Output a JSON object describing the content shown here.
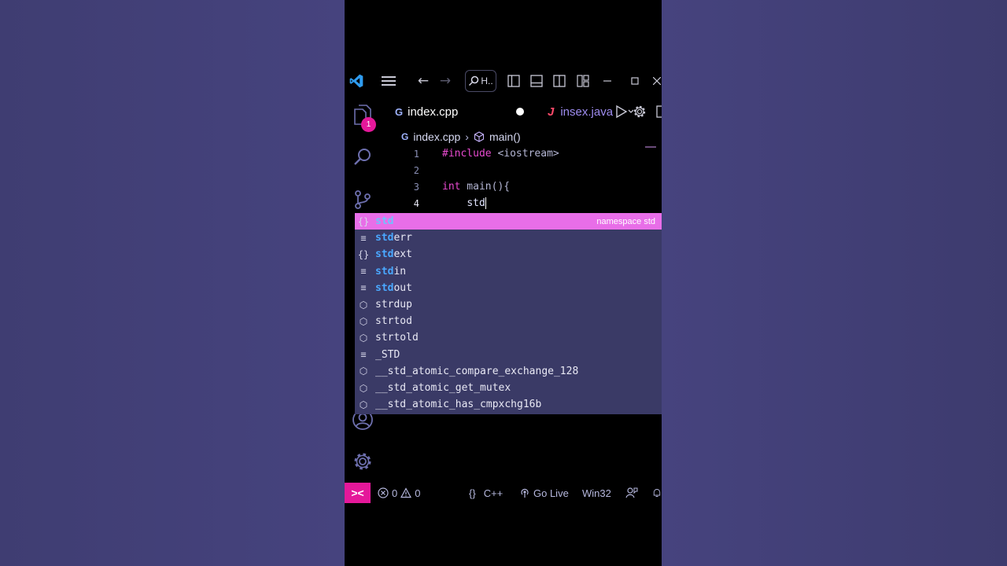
{
  "colors": {
    "accent": "#e5189a",
    "suggest_selected": "#e86ee8",
    "match_highlight": "#4aa8ff",
    "background": "#3f3f72"
  },
  "titlebar": {
    "search_label": "H..",
    "icons": [
      "vscode-logo-icon",
      "menu-icon",
      "back-arrow-icon",
      "forward-arrow-icon",
      "search-icon",
      "toggle-sidebar-icon",
      "toggle-panel-icon",
      "toggle-secondary-sidebar-icon",
      "customize-layout-icon",
      "minimize-icon",
      "maximize-icon",
      "close-icon"
    ]
  },
  "activity_bar": {
    "badge": "1",
    "icons": [
      "explorer-icon",
      "search-icon",
      "source-control-icon",
      "account-icon",
      "settings-gear-icon"
    ]
  },
  "tabs": [
    {
      "label": "index.cpp",
      "icon": "cpp-file-icon",
      "icon_glyph": "G",
      "active": true,
      "modified": true
    },
    {
      "label": "insex.java",
      "icon": "java-file-icon",
      "icon_glyph": "J",
      "active": false
    }
  ],
  "breadcrumb": {
    "file": "index.cpp",
    "file_icon_glyph": "G",
    "symbol": "main()"
  },
  "editor": {
    "lines": [
      {
        "number": "1",
        "hash": "#",
        "directive": "include",
        "rest": " <iostream>"
      },
      {
        "number": "2"
      },
      {
        "number": "3",
        "keyword": "int",
        "rest": " main(){"
      },
      {
        "number": "4",
        "indent": "    ",
        "text": "std"
      }
    ]
  },
  "suggestions": [
    {
      "match": "std",
      "rest": "",
      "kind": "namespace-icon",
      "glyph": "{}",
      "selected": true,
      "detail": "namespace std"
    },
    {
      "match": "std",
      "rest": "err",
      "kind": "variable-icon",
      "glyph": "≡"
    },
    {
      "match": "std",
      "rest": "ext",
      "kind": "namespace-icon",
      "glyph": "{}"
    },
    {
      "match": "std",
      "rest": "in",
      "kind": "variable-icon",
      "glyph": "≡"
    },
    {
      "match": "std",
      "rest": "out",
      "kind": "variable-icon",
      "glyph": "≡"
    },
    {
      "match": "",
      "rest": "strdup",
      "kind": "function-icon",
      "glyph": "⬡"
    },
    {
      "match": "",
      "rest": "strtod",
      "kind": "function-icon",
      "glyph": "⬡"
    },
    {
      "match": "",
      "rest": "strtold",
      "kind": "function-icon",
      "glyph": "⬡"
    },
    {
      "match": "",
      "rest": "_STD",
      "kind": "variable-icon",
      "glyph": "≡"
    },
    {
      "match": "",
      "rest": "__std_atomic_compare_exchange_128",
      "kind": "function-icon",
      "glyph": "⬡"
    },
    {
      "match": "",
      "rest": "__std_atomic_get_mutex",
      "kind": "function-icon",
      "glyph": "⬡"
    },
    {
      "match": "",
      "rest": "__std_atomic_has_cmpxchg16b",
      "kind": "function-icon",
      "glyph": "⬡"
    }
  ],
  "status_bar": {
    "remote_glyph": "><",
    "errors": "0",
    "warnings": "0",
    "language_glyph": "{}",
    "language": "C++",
    "golive": "Go Live",
    "platform": "Win32"
  }
}
